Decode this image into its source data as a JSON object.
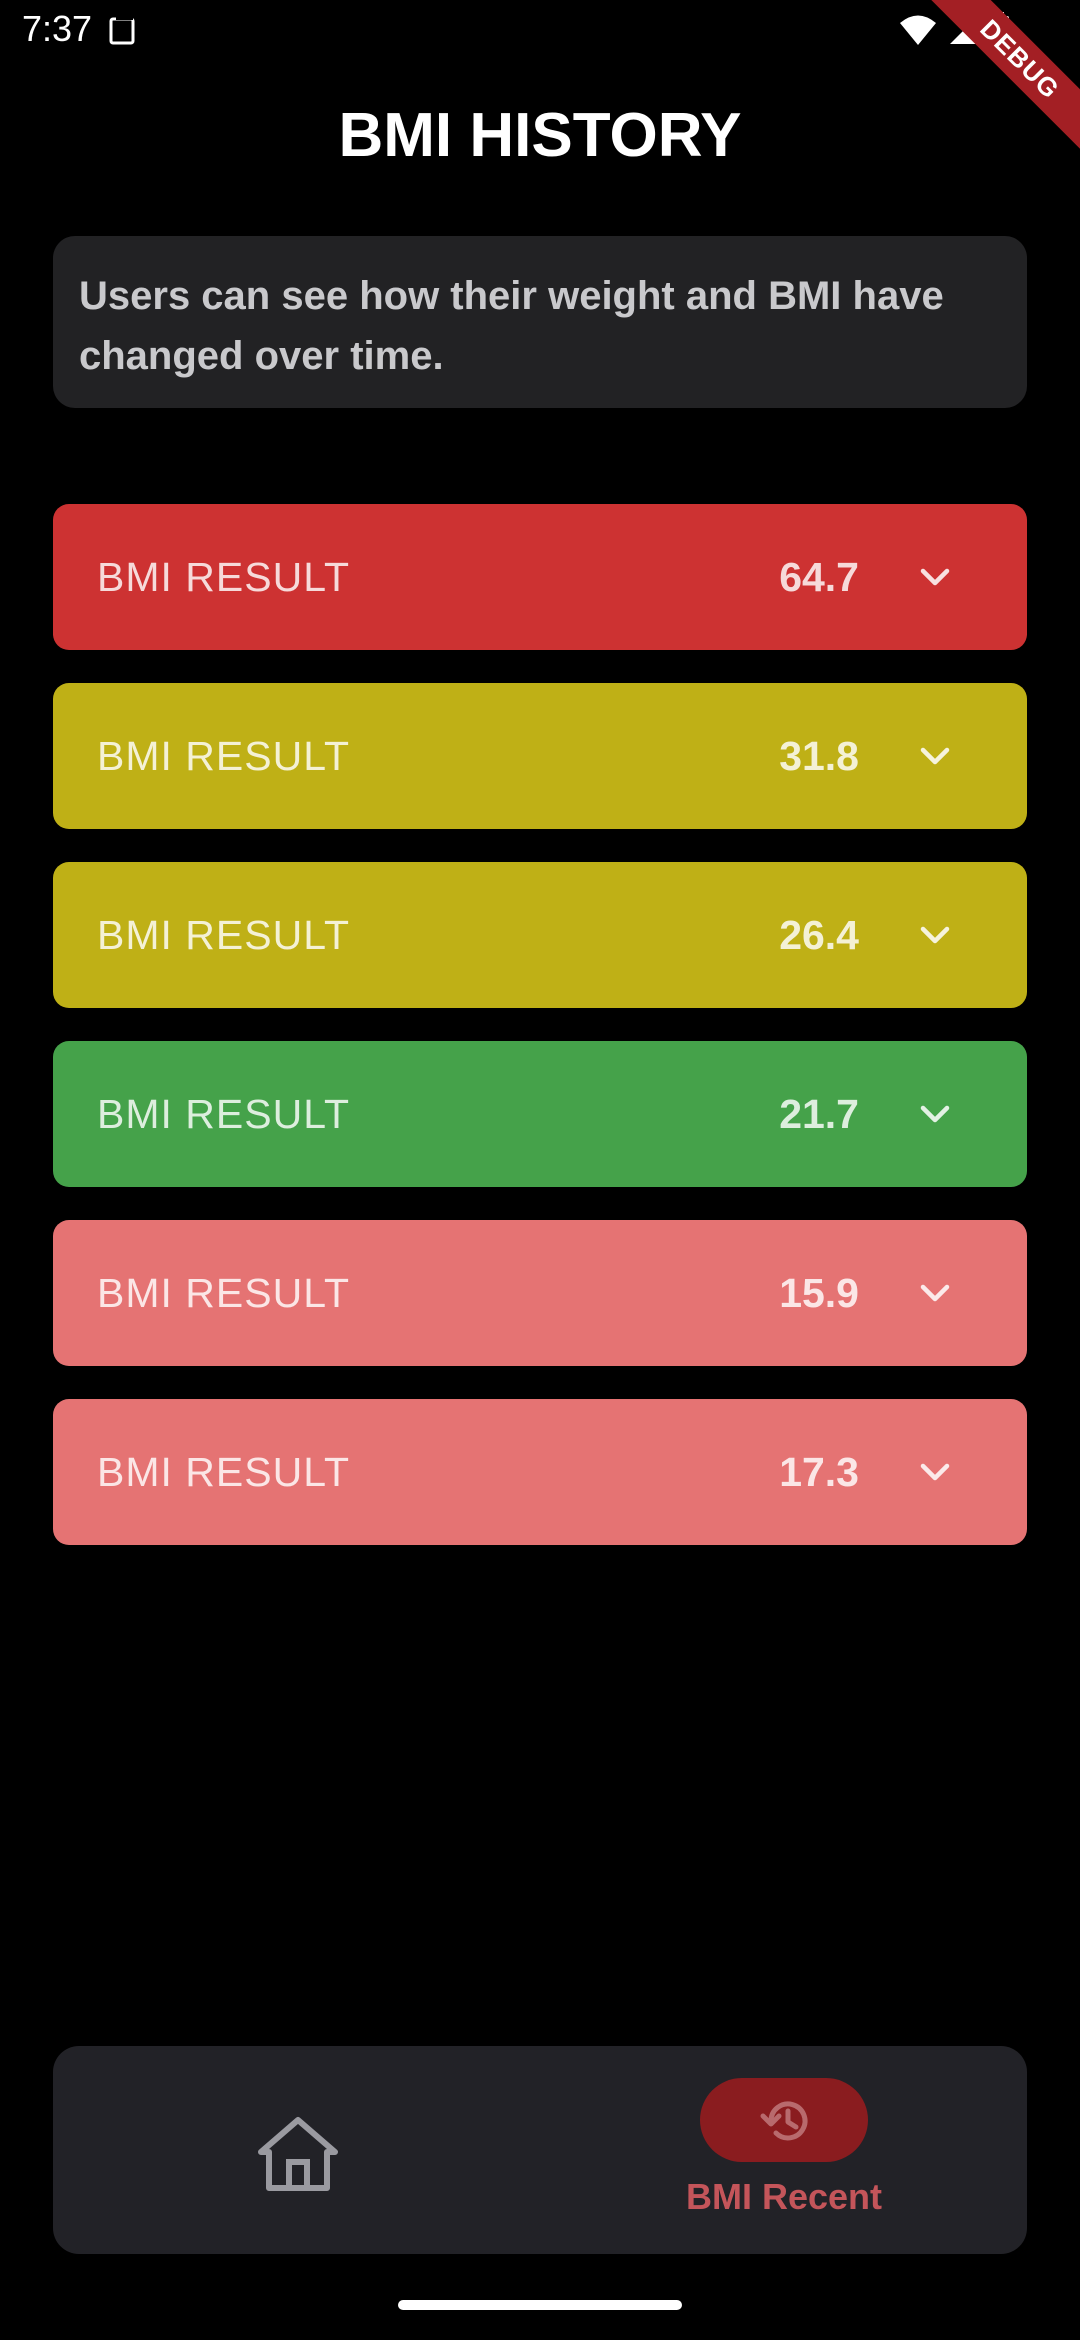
{
  "status_bar": {
    "time": "7:37",
    "icons": [
      "sim-card-icon",
      "wifi-icon",
      "cell-signal-icon",
      "battery-icon"
    ]
  },
  "debug_banner": "DEBUG",
  "page": {
    "title": "BMI HISTORY",
    "description": "Users can see how their weight and BMI have changed over time."
  },
  "results": [
    {
      "label": "BMI RESULT",
      "value": "64.7",
      "color": "#cd3232"
    },
    {
      "label": "BMI RESULT",
      "value": "31.8",
      "color": "#bfb016"
    },
    {
      "label": "BMI RESULT",
      "value": "26.4",
      "color": "#bfb016"
    },
    {
      "label": "BMI RESULT",
      "value": "21.7",
      "color": "#45a24a"
    },
    {
      "label": "BMI RESULT",
      "value": "15.9",
      "color": "#e57373"
    },
    {
      "label": "BMI RESULT",
      "value": "17.3",
      "color": "#e57373"
    }
  ],
  "bottom_nav": {
    "home_icon": "home-icon",
    "recent_icon": "history-icon",
    "recent_label": "BMI Recent",
    "active_color": "#8a1c1f"
  }
}
